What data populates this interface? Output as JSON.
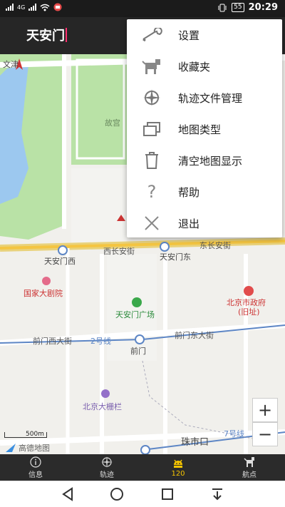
{
  "status_bar": {
    "battery": "55",
    "time": "20:29",
    "network": "4G"
  },
  "header": {
    "title": "天安门"
  },
  "map": {
    "labels": {
      "wenjin": "文津",
      "gugong": "故宫",
      "xichang": "西长安街",
      "dongchang": "东长安街",
      "tam_west": "天安门西",
      "tam_east": "天安门东",
      "theatre": "国家大剧院",
      "gov": "北京市政府",
      "gov_old": "(旧址)",
      "square": "天安门广场",
      "qm_west": "前门西大街",
      "qm_east": "前门东大街",
      "line2": "2号线",
      "qianmen": "前门",
      "dashilan": "北京大栅栏",
      "zhushikou": "珠市口",
      "line7": "7号线",
      "scale": "500m",
      "brand": "高德地图"
    },
    "zoom_in": "+",
    "zoom_out": "−"
  },
  "menu": {
    "items": [
      {
        "label": "设置",
        "icon": "wrench-icon"
      },
      {
        "label": "收藏夹",
        "icon": "pet-icon"
      },
      {
        "label": "轨迹文件管理",
        "icon": "compass-icon"
      },
      {
        "label": "地图类型",
        "icon": "layers-icon"
      },
      {
        "label": "清空地图显示",
        "icon": "trash-icon"
      },
      {
        "label": "帮助",
        "icon": "question-icon"
      },
      {
        "label": "退出",
        "icon": "close-icon"
      }
    ]
  },
  "bottom_nav": {
    "items": [
      {
        "label": "信息",
        "icon": "info-icon"
      },
      {
        "label": "轨迹",
        "icon": "compass-icon"
      },
      {
        "label": "120",
        "icon": "android-icon"
      },
      {
        "label": "航点",
        "icon": "waypoint-icon"
      }
    ]
  },
  "colors": {
    "accent_active": "#f5c400",
    "cursor": "#ff2e6e",
    "park": "#b9e2a6",
    "water": "#9cc8ef",
    "road_major": "#f4c542"
  }
}
